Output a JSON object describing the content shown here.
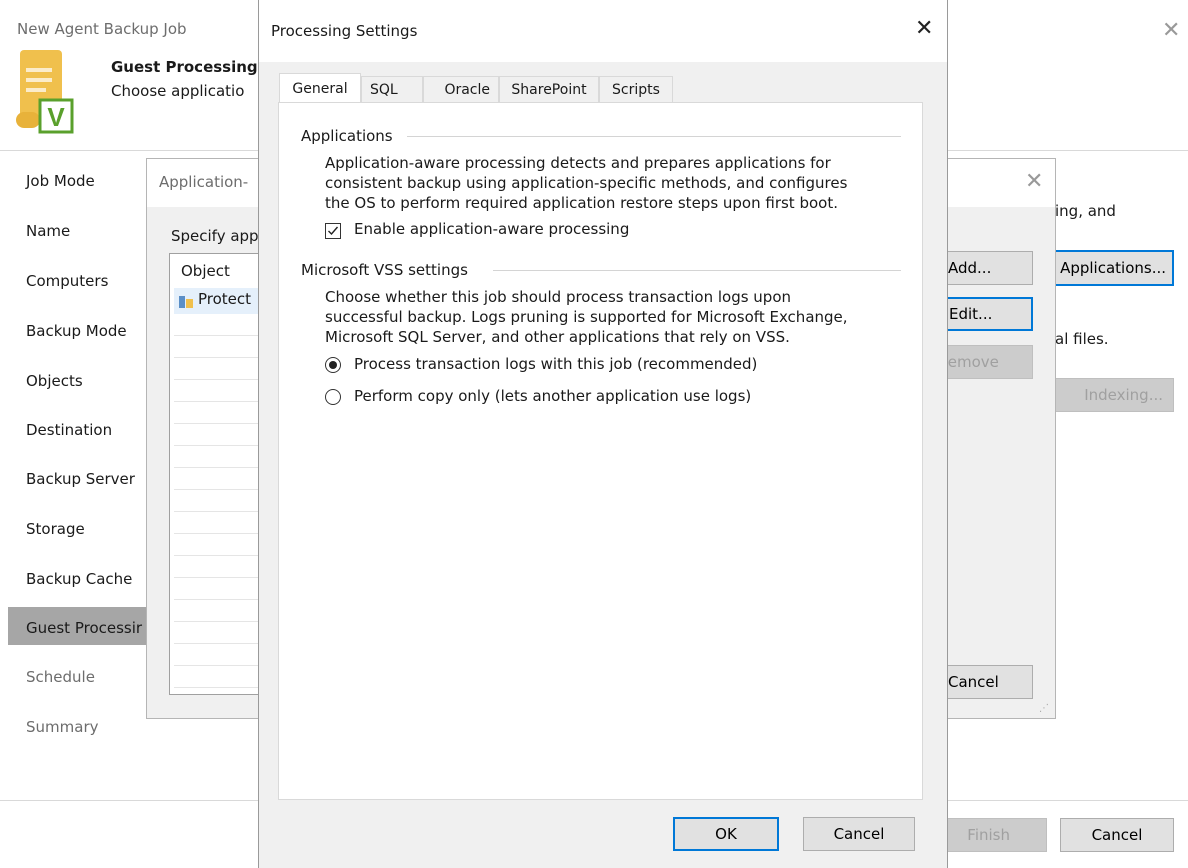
{
  "wizard": {
    "title": "New Agent Backup Job",
    "step_title": "Guest Processing",
    "step_subtitle": "Choose applicatio",
    "nav": [
      {
        "label": "Job Mode"
      },
      {
        "label": "Name"
      },
      {
        "label": "Computers"
      },
      {
        "label": "Backup Mode"
      },
      {
        "label": "Objects"
      },
      {
        "label": "Destination"
      },
      {
        "label": "Backup Server"
      },
      {
        "label": "Storage"
      },
      {
        "label": "Backup Cache"
      },
      {
        "label": "Guest Processir"
      },
      {
        "label": "Schedule"
      },
      {
        "label": "Summary"
      }
    ],
    "right_text1": "ing, and",
    "right_text2": "al files.",
    "applications_btn": "Applications...",
    "indexing_btn": "Indexing...",
    "finish_btn": "Finish",
    "cancel_btn": "Cancel"
  },
  "app_dialog": {
    "title": "Application-",
    "specify_label": "Specify app",
    "col_object": "Object",
    "row1": "Protect",
    "add_btn": "Add...",
    "edit_btn": "Edit...",
    "remove_btn": "Remove",
    "cancel_btn": "Cancel"
  },
  "processing": {
    "title": "Processing Settings",
    "tabs": [
      {
        "label": "General"
      },
      {
        "label": "SQL"
      },
      {
        "label": "Oracle"
      },
      {
        "label": "SharePoint"
      },
      {
        "label": "Scripts"
      }
    ],
    "applications_group": "Applications",
    "applications_desc1": "Application-aware processing detects and prepares applications for",
    "applications_desc2": "consistent backup using application-specific methods, and configures",
    "applications_desc3": "the OS to perform required application restore steps upon first boot.",
    "enable_checkbox": "Enable application-aware processing",
    "enable_checked": true,
    "vss_group": "Microsoft VSS settings",
    "vss_desc1": "Choose whether this job should process transaction logs upon",
    "vss_desc2": "successful backup. Logs pruning is supported for Microsoft Exchange,",
    "vss_desc3": "Microsoft SQL Server, and other applications that rely on VSS.",
    "radio1": "Process transaction logs with this job (recommended)",
    "radio2": "Perform copy only (lets another application use logs)",
    "ok_btn": "OK",
    "cancel_btn": "Cancel"
  },
  "colors": {
    "accent": "#0078d7",
    "nav_selected": "#a6a6a6",
    "logo_v": "#5aa02c",
    "logo_scroll": "#f0c04d"
  }
}
